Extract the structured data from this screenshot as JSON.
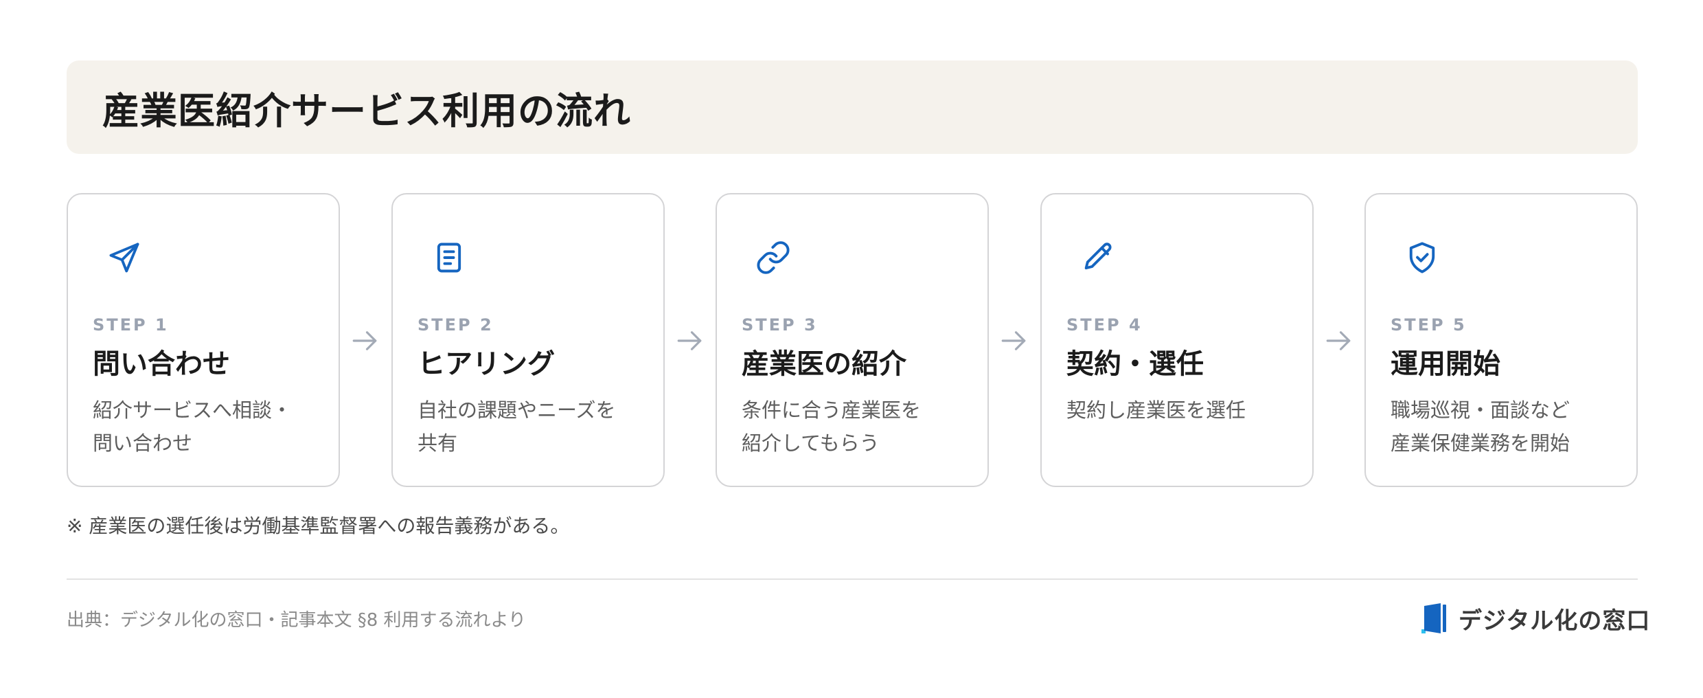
{
  "title": "産業医紹介サービス利用の流れ",
  "accent_color": "#1565c0",
  "steps": [
    {
      "label": "STEP 1",
      "title": "問い合わせ",
      "desc_line1": "紹介サービスへ相談・",
      "desc_line2": "問い合わせ",
      "icon": "send-icon"
    },
    {
      "label": "STEP 2",
      "title": "ヒアリング",
      "desc_line1": "自社の課題やニーズを",
      "desc_line2": "共有",
      "icon": "document-icon"
    },
    {
      "label": "STEP 3",
      "title": "産業医の紹介",
      "desc_line1": "条件に合う産業医を",
      "desc_line2": "紹介してもらう",
      "icon": "link-icon"
    },
    {
      "label": "STEP 4",
      "title": "契約・選任",
      "desc_line1": "契約し産業医を選任",
      "desc_line2": "",
      "icon": "pencil-icon"
    },
    {
      "label": "STEP 5",
      "title": "運用開始",
      "desc_line1": "職場巡視・面談など",
      "desc_line2": "産業保健業務を開始",
      "icon": "shield-check-icon"
    }
  ],
  "note": "※ 産業医の選任後は労働基準監督署への報告義務がある。",
  "source": "出典：デジタル化の窓口・記事本文 §8 利用する流れより",
  "brand": {
    "name": "デジタル化の窓口",
    "icon": "door-logo-icon"
  }
}
